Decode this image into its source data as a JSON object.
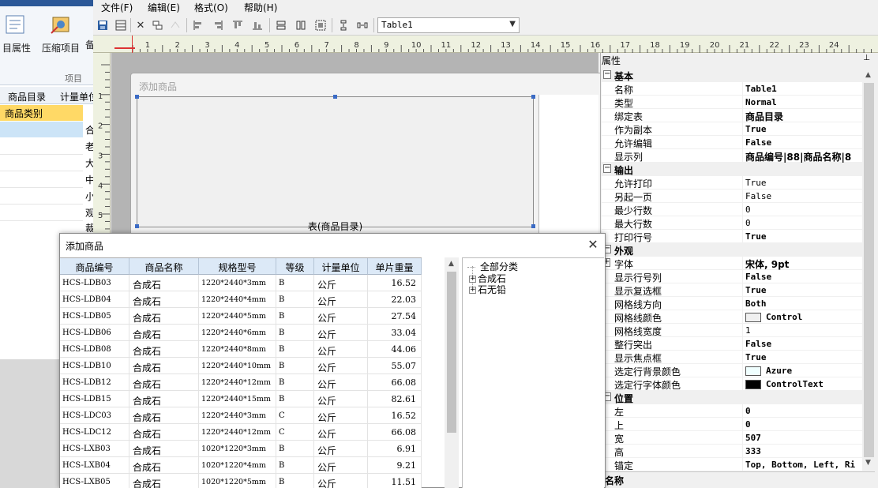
{
  "background_app": {
    "ribbon_buttons": [
      {
        "label": "目属性",
        "icon": "properties-icon"
      },
      {
        "label": "压缩项目",
        "icon": "compress-icon"
      },
      {
        "label": "备",
        "icon": "backup-icon"
      }
    ],
    "group_label": "项目",
    "tabs": [
      "商品目录",
      "计量单位"
    ],
    "selected_item": "商品类别",
    "side_chars": [
      "合",
      "老",
      "大",
      "中",
      "小",
      "观",
      "裁"
    ]
  },
  "menu": [
    "文件(F)",
    "编辑(E)",
    "格式(O)",
    "帮助(H)"
  ],
  "toolbar": {
    "table_select_value": "Table1"
  },
  "ruler": {
    "h_numbers": [
      "1",
      "2",
      "3",
      "4",
      "5",
      "6",
      "7",
      "8",
      "9",
      "10",
      "11",
      "12",
      "13",
      "14",
      "15",
      "16",
      "17",
      "18",
      "19",
      "20",
      "21",
      "22",
      "23",
      "24"
    ],
    "v_numbers": [
      "1",
      "2",
      "3",
      "4",
      "5",
      "6"
    ]
  },
  "designer_form": {
    "title": "添加商品",
    "table_caption": "表(商品目录)"
  },
  "properties": {
    "header": "属性",
    "footer": "名称",
    "rows": [
      {
        "type": "cat",
        "name": "基本"
      },
      {
        "type": "prop",
        "name": "名称",
        "value": "Table1",
        "style": "bold"
      },
      {
        "type": "prop",
        "name": "类型",
        "value": "Normal",
        "style": "bold"
      },
      {
        "type": "prop",
        "name": "绑定表",
        "value": "商品目录",
        "style": "cjk"
      },
      {
        "type": "prop",
        "name": "作为副本",
        "value": "True",
        "style": "bold"
      },
      {
        "type": "prop",
        "name": "允许编辑",
        "value": "False",
        "style": "bold"
      },
      {
        "type": "prop",
        "name": "显示列",
        "value": "商品编号|88|商品名称|8",
        "style": "cjk"
      },
      {
        "type": "cat",
        "name": "输出"
      },
      {
        "type": "prop",
        "name": "允许打印",
        "value": "True",
        "style": ""
      },
      {
        "type": "prop",
        "name": "另起一页",
        "value": "False",
        "style": ""
      },
      {
        "type": "prop",
        "name": "最少行数",
        "value": "0",
        "style": ""
      },
      {
        "type": "prop",
        "name": "最大行数",
        "value": "0",
        "style": ""
      },
      {
        "type": "prop",
        "name": "打印行号",
        "value": "True",
        "style": "bold"
      },
      {
        "type": "cat",
        "name": "外观"
      },
      {
        "type": "prop",
        "name": "字体",
        "value": "宋体, 9pt",
        "style": "cjk",
        "expander": true
      },
      {
        "type": "prop",
        "name": "显示行号列",
        "value": "False",
        "style": "bold"
      },
      {
        "type": "prop",
        "name": "显示复选框",
        "value": "True",
        "style": "bold"
      },
      {
        "type": "prop",
        "name": "网格线方向",
        "value": "Both",
        "style": "bold"
      },
      {
        "type": "prop",
        "name": "网格线颜色",
        "value": "Control",
        "style": "bold",
        "swatch": "#f0f0f0"
      },
      {
        "type": "prop",
        "name": "网格线宽度",
        "value": "1",
        "style": ""
      },
      {
        "type": "prop",
        "name": "整行突出",
        "value": "False",
        "style": "bold"
      },
      {
        "type": "prop",
        "name": "显示焦点框",
        "value": "True",
        "style": "bold"
      },
      {
        "type": "prop",
        "name": "选定行背景颜色",
        "value": "Azure",
        "style": "bold",
        "swatch": "#f0ffff"
      },
      {
        "type": "prop",
        "name": "选定行字体颜色",
        "value": "ControlText",
        "style": "bold",
        "swatch": "#000000"
      },
      {
        "type": "cat",
        "name": "位置"
      },
      {
        "type": "prop",
        "name": "左",
        "value": "0",
        "style": "bold"
      },
      {
        "type": "prop",
        "name": "上",
        "value": "0",
        "style": "bold"
      },
      {
        "type": "prop",
        "name": "宽",
        "value": "507",
        "style": "bold"
      },
      {
        "type": "prop",
        "name": "高",
        "value": "333",
        "style": "bold"
      },
      {
        "type": "prop",
        "name": "锚定",
        "value": "Top, Bottom, Left, Ri",
        "style": "bold"
      }
    ]
  },
  "dialog": {
    "title": "添加商品",
    "columns": [
      "商品编号",
      "商品名称",
      "规格型号",
      "等级",
      "计量单位",
      "单片重量"
    ],
    "rows": [
      [
        "HCS-LDB03",
        "合成石",
        "1220*2440*3mm",
        "B",
        "公斤",
        "16.52"
      ],
      [
        "HCS-LDB04",
        "合成石",
        "1220*2440*4mm",
        "B",
        "公斤",
        "22.03"
      ],
      [
        "HCS-LDB05",
        "合成石",
        "1220*2440*5mm",
        "B",
        "公斤",
        "27.54"
      ],
      [
        "HCS-LDB06",
        "合成石",
        "1220*2440*6mm",
        "B",
        "公斤",
        "33.04"
      ],
      [
        "HCS-LDB08",
        "合成石",
        "1220*2440*8mm",
        "B",
        "公斤",
        "44.06"
      ],
      [
        "HCS-LDB10",
        "合成石",
        "1220*2440*10mm",
        "B",
        "公斤",
        "55.07"
      ],
      [
        "HCS-LDB12",
        "合成石",
        "1220*2440*12mm",
        "B",
        "公斤",
        "66.08"
      ],
      [
        "HCS-LDB15",
        "合成石",
        "1220*2440*15mm",
        "B",
        "公斤",
        "82.61"
      ],
      [
        "HCS-LDC03",
        "合成石",
        "1220*2440*3mm",
        "C",
        "公斤",
        "16.52"
      ],
      [
        "HCS-LDC12",
        "合成石",
        "1220*2440*12mm",
        "C",
        "公斤",
        "66.08"
      ],
      [
        "HCS-LXB03",
        "合成石",
        "1020*1220*3mm",
        "B",
        "公斤",
        "6.91"
      ],
      [
        "HCS-LXB04",
        "合成石",
        "1020*1220*4mm",
        "B",
        "公斤",
        "9.21"
      ],
      [
        "HCS-LXB05",
        "合成石",
        "1020*1220*5mm",
        "B",
        "公斤",
        "11.51"
      ]
    ],
    "tree": {
      "root": "全部分类",
      "children": [
        "合成石",
        "石无铅"
      ]
    }
  }
}
